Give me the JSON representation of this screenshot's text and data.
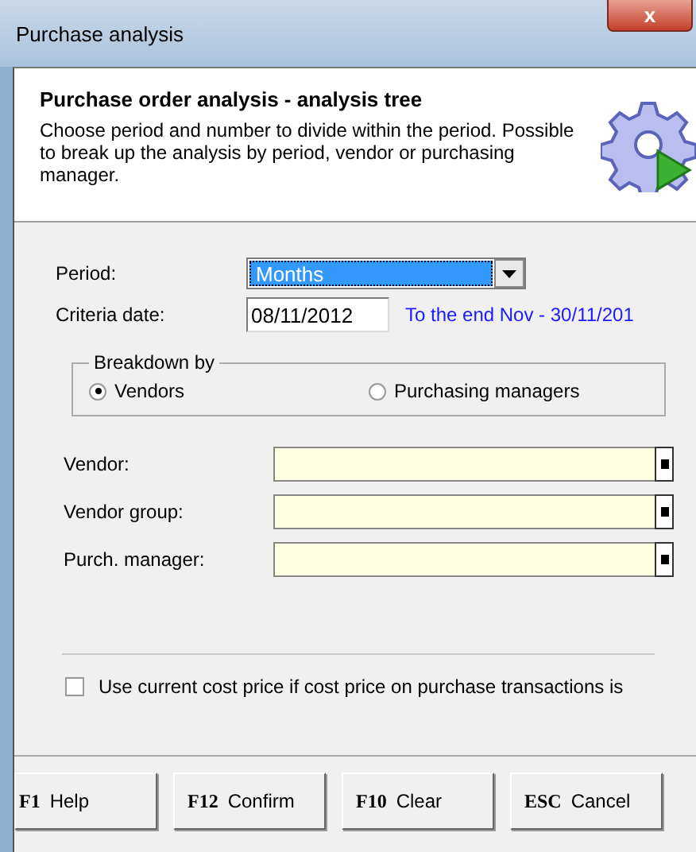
{
  "window": {
    "title": "Purchase analysis",
    "close": "x"
  },
  "header": {
    "title": "Purchase order analysis - analysis tree",
    "description": "Choose period and number to divide within the period. Possible to break up the analysis by period, vendor or purchasing manager."
  },
  "period": {
    "label": "Period:",
    "value": "Months"
  },
  "criteria_date": {
    "label": "Criteria date:",
    "value": "08/11/2012",
    "range": "To the end Nov - 30/11/201"
  },
  "breakdown": {
    "title": "Breakdown by",
    "options": [
      {
        "label": "Vendors",
        "selected": true
      },
      {
        "label": "Purchasing managers",
        "selected": false
      }
    ]
  },
  "lookups": [
    {
      "label": "Vendor:"
    },
    {
      "label": "Vendor group:"
    },
    {
      "label": "Purch. manager:"
    }
  ],
  "cost_price": {
    "label": "Use current cost price if cost price on purchase transactions is",
    "checked": false
  },
  "buttons": [
    {
      "key": "F1",
      "label": "Help"
    },
    {
      "key": "F12",
      "label": "Confirm"
    },
    {
      "key": "F10",
      "label": "Clear"
    },
    {
      "key": "ESC",
      "label": "Cancel"
    }
  ]
}
